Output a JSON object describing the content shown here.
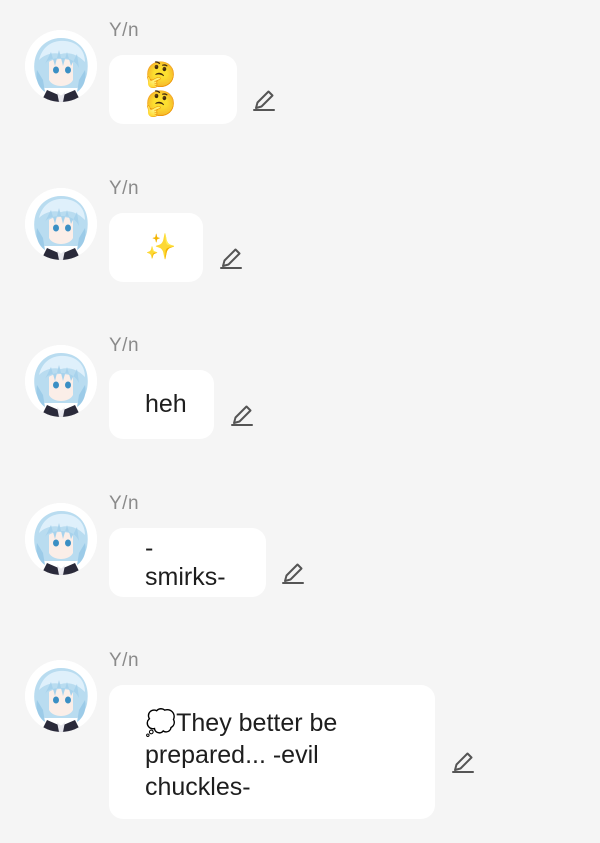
{
  "messages": [
    {
      "sender": "Y/n",
      "text": "🤔🤔"
    },
    {
      "sender": "Y/n",
      "text": "✨"
    },
    {
      "sender": "Y/n",
      "text": "heh"
    },
    {
      "sender": "Y/n",
      "text": "-smirks-"
    },
    {
      "sender": "Y/n",
      "text": "💭They better be prepared... -evil chuckles-"
    }
  ],
  "icons": {
    "avatar": "character-avatar-icon",
    "edit": "pencil-edit-icon"
  },
  "colors": {
    "background": "#f5f5f5",
    "bubble": "#ffffff",
    "sender": "#8a8a8a",
    "text": "#1e1e1e",
    "edit_icon": "#555555"
  }
}
